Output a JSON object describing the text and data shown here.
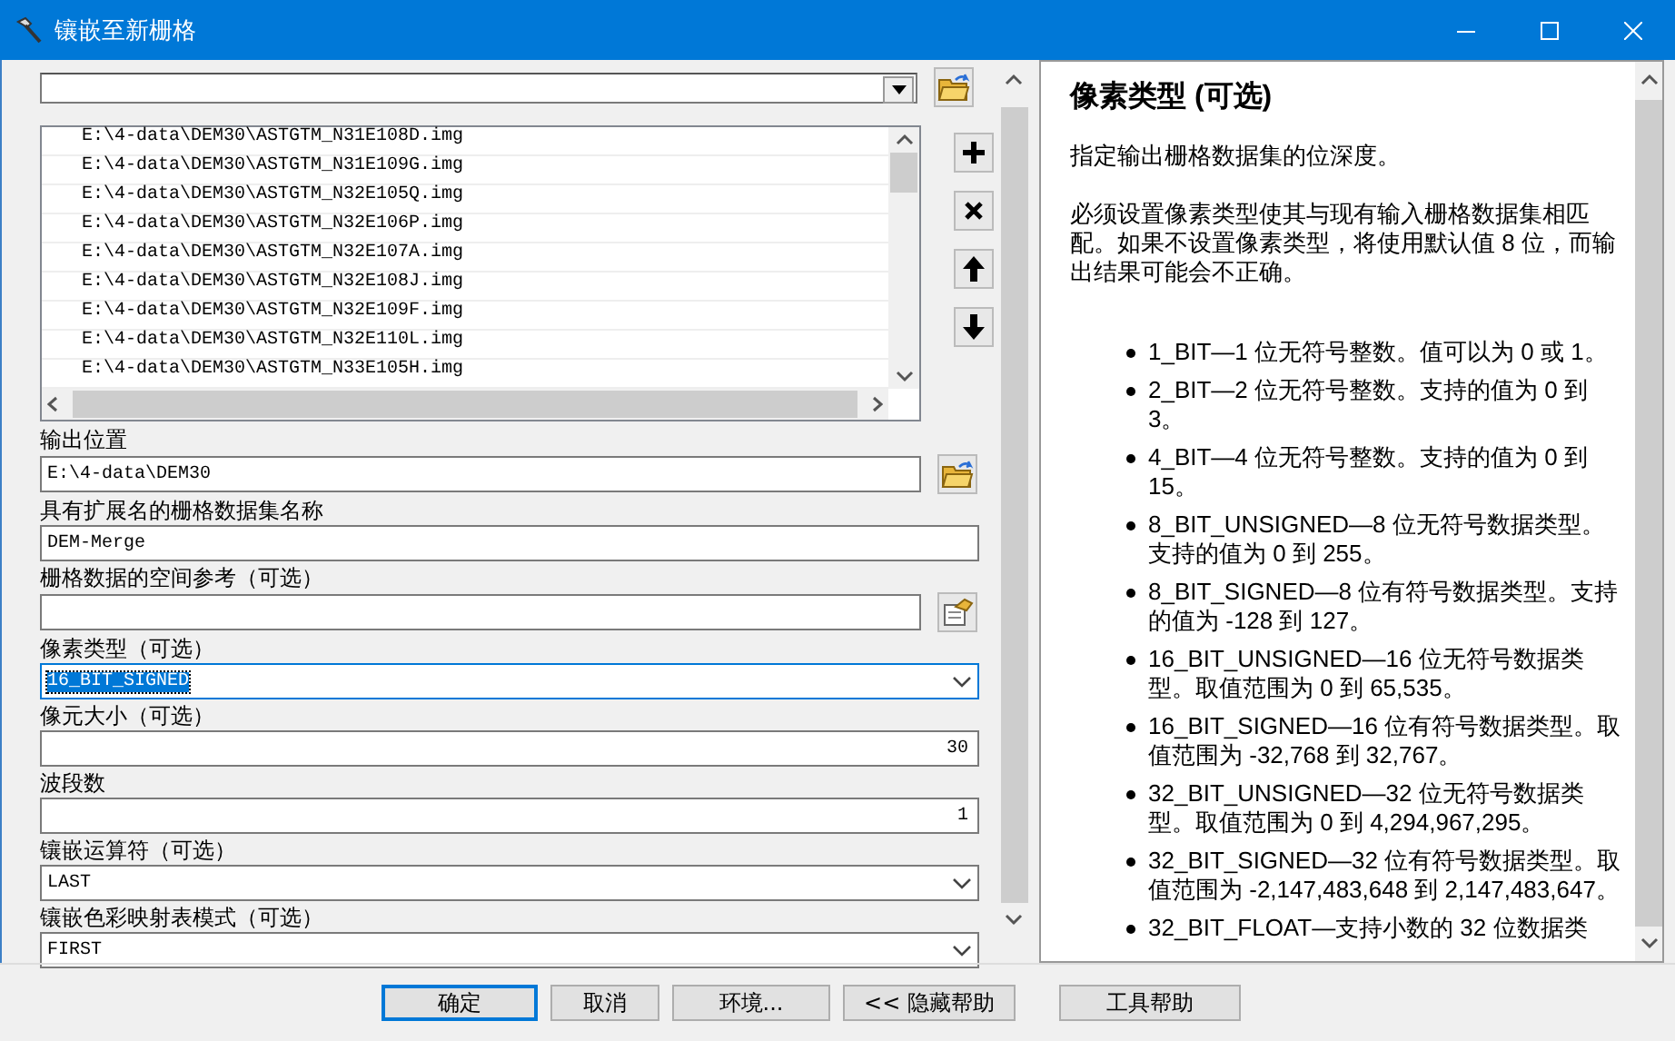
{
  "window": {
    "title": "镶嵌至新栅格"
  },
  "input_rasters": {
    "items": [
      "E:\\4-data\\DEM30\\ASTGTM_N31E108D.img",
      "E:\\4-data\\DEM30\\ASTGTM_N31E109G.img",
      "E:\\4-data\\DEM30\\ASTGTM_N32E105Q.img",
      "E:\\4-data\\DEM30\\ASTGTM_N32E106P.img",
      "E:\\4-data\\DEM30\\ASTGTM_N32E107A.img",
      "E:\\4-data\\DEM30\\ASTGTM_N32E108J.img",
      "E:\\4-data\\DEM30\\ASTGTM_N32E109F.img",
      "E:\\4-data\\DEM30\\ASTGTM_N32E110L.img",
      "E:\\4-data\\DEM30\\ASTGTM_N33E105H.img"
    ]
  },
  "fields": [
    {
      "kind": "path",
      "label": "输出位置",
      "value": "E:\\4-data\\DEM30",
      "focused": false
    },
    {
      "kind": "text",
      "label": "具有扩展名的栅格数据集名称",
      "value": "DEM-Merge",
      "focused": false
    },
    {
      "kind": "spatial",
      "label": "栅格数据的空间参考（可选）",
      "focused": false
    },
    {
      "kind": "dropdown",
      "label": "像素类型（可选）",
      "value": "16_BIT_SIGNED",
      "focused": true
    },
    {
      "kind": "number",
      "label": "像元大小（可选）",
      "value": "30",
      "focused": false
    },
    {
      "kind": "number",
      "label": "波段数",
      "value": "1",
      "focused": false
    },
    {
      "kind": "dropdown",
      "label": "镶嵌运算符（可选）",
      "value": "LAST",
      "focused": false
    },
    {
      "kind": "dropdown",
      "label": "镶嵌色彩映射表模式（可选）",
      "value": "FIRST",
      "focused": false
    }
  ],
  "help": {
    "title": "像素类型 (可选)",
    "paragraphs": [
      "指定输出栅格数据集的位深度。",
      "必须设置像素类型使其与现有输入栅格数据集相匹配。如果不设置像素类型，将使用默认值 8 位，而输出结果可能会不正确。"
    ],
    "bullets": [
      "1_BIT—1 位无符号整数。值可以为  0 或  1。",
      "2_BIT—2 位无符号整数。支持的值为  0 到  3。",
      "4_BIT—4 位无符号整数。支持的值为  0 到  15。",
      "8_BIT_UNSIGNED—8 位无符号数据类型。支持的值为  0 到  255。",
      "8_BIT_SIGNED—8 位有符号数据类型。支持的值为  -128 到  127。",
      "16_BIT_UNSIGNED—16 位无符号数据类型。取值范围为  0 到  65,535。",
      "16_BIT_SIGNED—16 位有符号数据类型。取值范围为  -32,768 到  32,767。",
      "32_BIT_UNSIGNED—32 位无符号数据类型。取值范围为  0 到  4,294,967,295。",
      "32_BIT_SIGNED—32 位有符号数据类型。取值范围为  -2,147,483,648 到  2,147,483,647。",
      "32_BIT_FLOAT—支持小数的  32 位数据类"
    ]
  },
  "buttons": [
    {
      "label": "确定",
      "default": true
    },
    {
      "label": "取消",
      "default": false
    },
    {
      "label": "环境...",
      "default": false
    },
    {
      "label": "<< 隐藏帮助",
      "default": false
    },
    {
      "label": "工具帮助",
      "default": false
    }
  ]
}
